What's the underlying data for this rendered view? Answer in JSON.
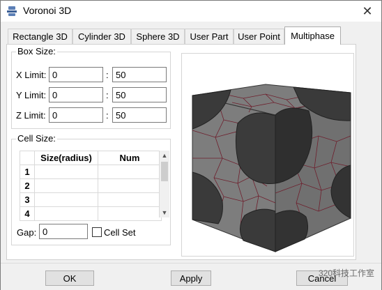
{
  "window": {
    "title": "Voronoi 3D"
  },
  "tabs": [
    "Rectangle 3D",
    "Cylinder 3D",
    "Sphere 3D",
    "User Part",
    "User Point",
    "Multiphase"
  ],
  "active_tab": "Multiphase",
  "box_size": {
    "label": "Box Size:",
    "rows": [
      {
        "label": "X Limit:",
        "min": "0",
        "sep": ":",
        "max": "50"
      },
      {
        "label": "Y Limit:",
        "min": "0",
        "sep": ":",
        "max": "50"
      },
      {
        "label": "Z Limit:",
        "min": "0",
        "sep": ":",
        "max": "50"
      }
    ]
  },
  "cell_size": {
    "label": "Cell Size:",
    "columns": [
      "Size(radius)",
      "Num"
    ],
    "row_numbers": [
      "1",
      "2",
      "3",
      "4"
    ]
  },
  "gap": {
    "label": "Gap:",
    "value": "0"
  },
  "cell_set": {
    "label": "Cell Set",
    "checked": false
  },
  "buttons": {
    "ok": "OK",
    "apply": "Apply",
    "cancel": "Cancel"
  },
  "watermark": "320科技工作室",
  "colors": {
    "cube_dark": "#3a3a3a",
    "grain_gray": "#7d7d7d",
    "grain_edge": "#6e1e2c"
  }
}
